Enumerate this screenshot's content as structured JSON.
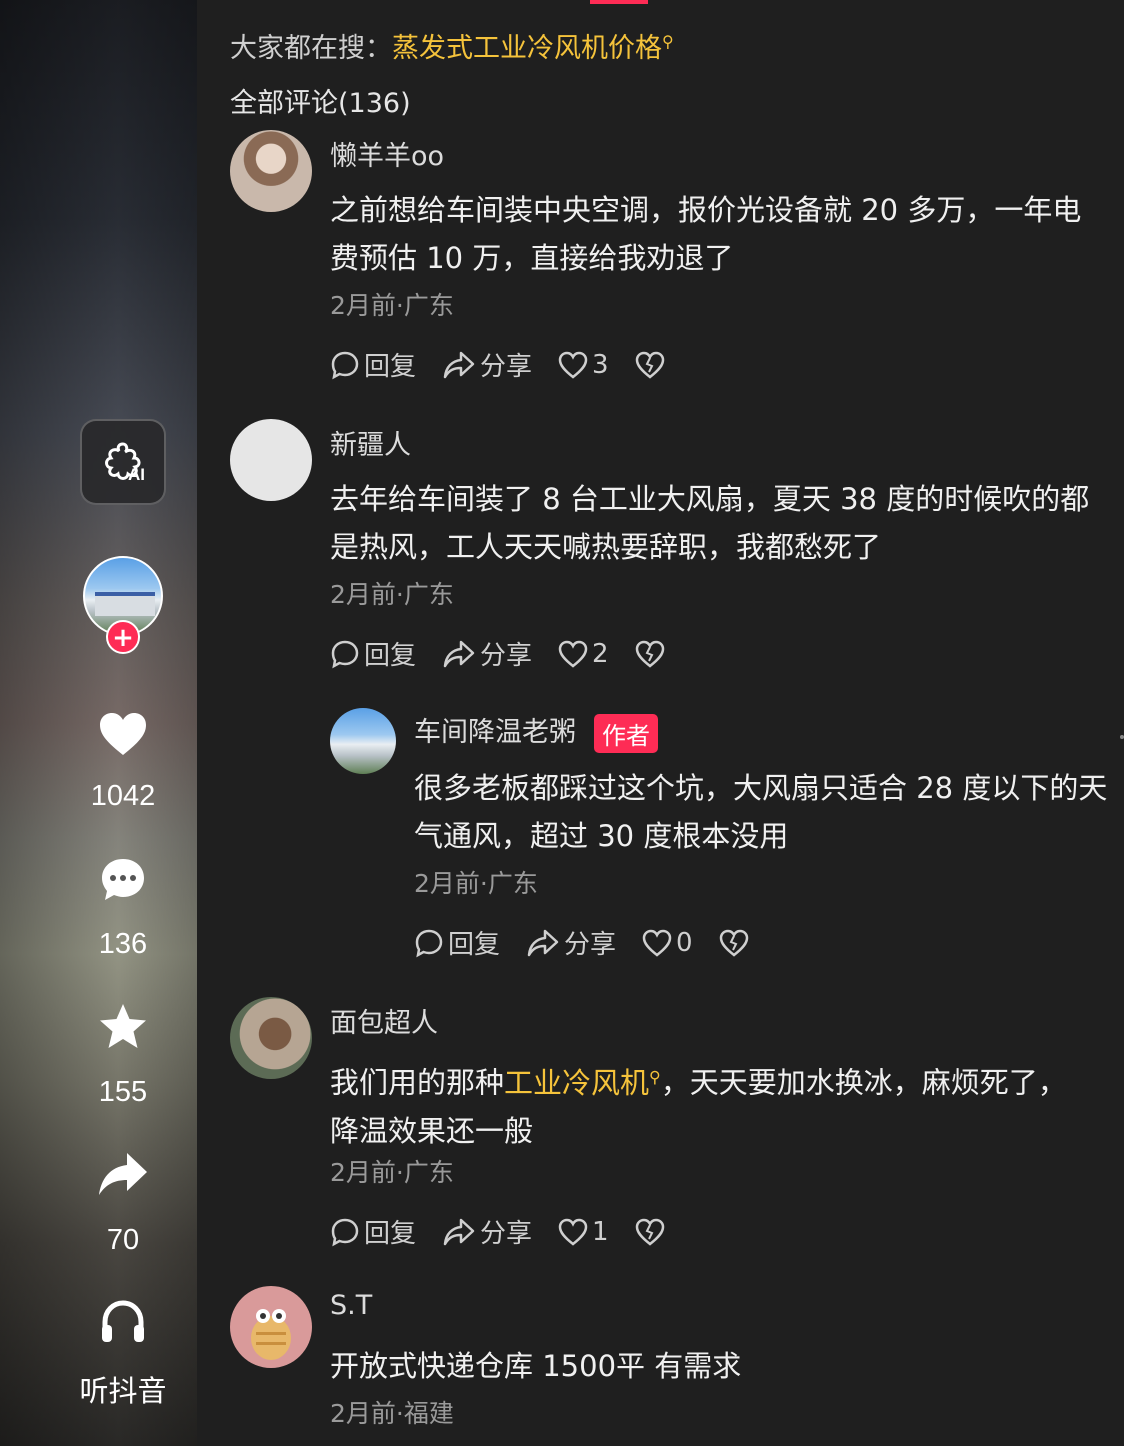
{
  "sidebar": {
    "ai_label": "AI",
    "likes": "1042",
    "comments": "136",
    "favorites": "155",
    "shares": "70",
    "listen_label": "听抖音"
  },
  "search_suggest": {
    "prefix": "大家都在搜：",
    "term": "蒸发式工业冷风机价格"
  },
  "comments_header": "全部评论(136)",
  "actions": {
    "reply": "回复",
    "share": "分享"
  },
  "comments": [
    {
      "name": "懒羊羊oo",
      "line1": "之前想给车间装中央空调，报价光设备就 20 多万，一年电",
      "line2": "费预估 10 万，直接给我劝退了",
      "meta": "2月前·广东",
      "likes": "3"
    },
    {
      "name": "新疆人",
      "line1": "去年给车间装了 8 台工业大风扇，夏天 38 度的时候吹的都",
      "line2": "是热风，工人天天喊热要辞职，我都愁死了",
      "meta": "2月前·广东",
      "likes": "2"
    },
    {
      "name": "车间降温老粥",
      "author_tag": "作者",
      "line1": "很多老板都踩过这个坑，大风扇只适合 28 度以下的天",
      "line2": "气通风，超过 30 度根本没用",
      "meta": "2月前·广东",
      "likes": "0"
    },
    {
      "name": "面包超人",
      "line1_pre": "我们用的那种",
      "line1_link": "工业冷风机",
      "line1_post": "，天天要加水换冰，麻烦死了，",
      "line2": "降温效果还一般",
      "meta": "2月前·广东",
      "likes": "1"
    },
    {
      "name": "S.T",
      "line1": "开放式快递仓库 1500平 有需求",
      "meta": "2月前·福建"
    }
  ],
  "colors": {
    "accent": "#fe2c55",
    "highlight": "#f5c33b",
    "bg": "#1f1f1f"
  }
}
